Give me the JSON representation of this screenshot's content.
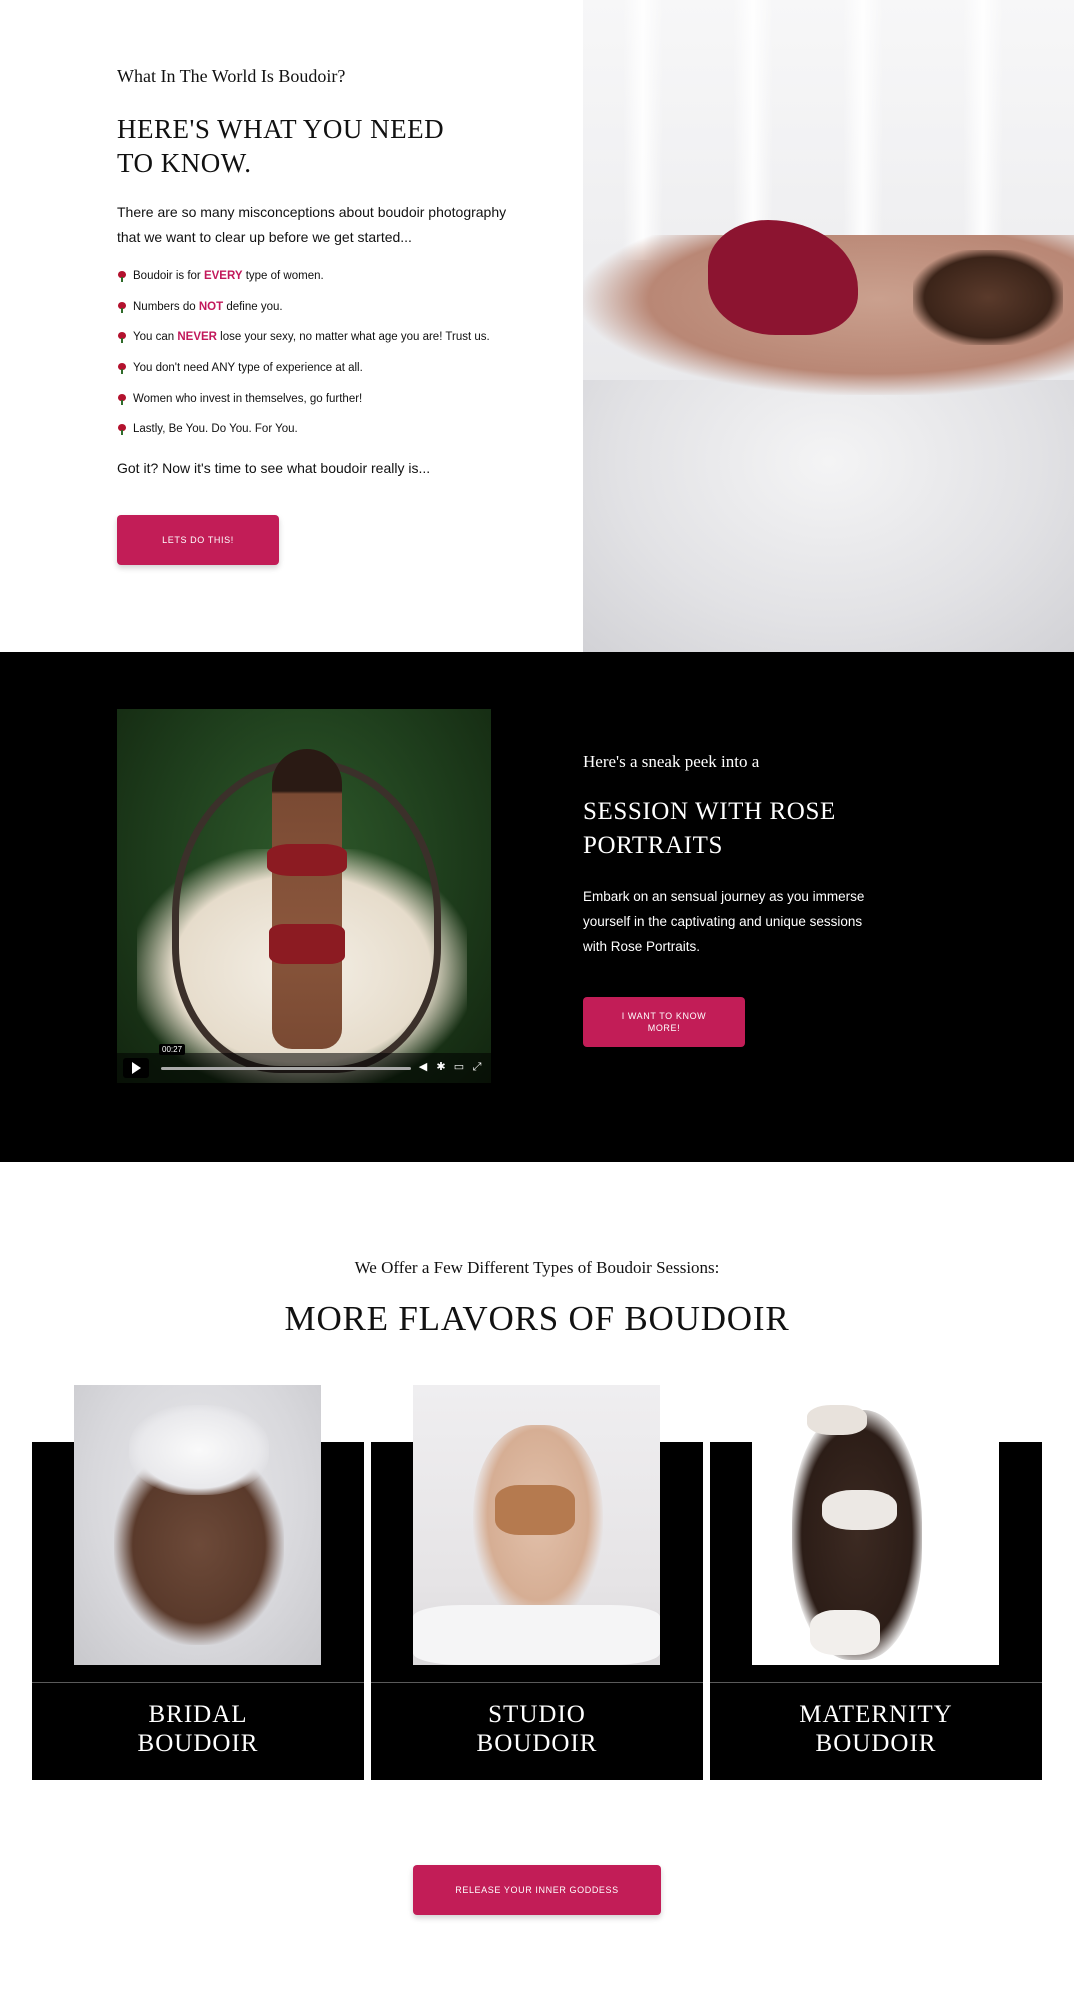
{
  "intro_section": {
    "eyebrow": "What In The World Is Boudoir?",
    "headline": "HERE'S WHAT YOU NEED TO KNOW.",
    "intro": "There are so many misconceptions about boudoir photography that we want to clear up before we get started...",
    "bullets": [
      {
        "before": "Boudoir is for ",
        "highlight": "EVERY",
        "after": " type of women."
      },
      {
        "before": "Numbers do ",
        "highlight": "NOT",
        "after": " define you."
      },
      {
        "before": "You can ",
        "highlight": "NEVER",
        "after": " lose your sexy, no matter what age you are! Trust us."
      },
      {
        "before": "You don't need ANY type of experience at all.",
        "highlight": "",
        "after": ""
      },
      {
        "before": "Women who invest in themselves, go further!",
        "highlight": "",
        "after": ""
      },
      {
        "before": "Lastly, Be You. Do You. For You.",
        "highlight": "",
        "after": ""
      }
    ],
    "closing": "Got it? Now it's time to see what boudoir really is...",
    "cta_label": "LETS DO THIS!"
  },
  "video_section": {
    "eyebrow": "Here's a sneak peek into a",
    "headline": "SESSION WITH ROSE PORTRAITS",
    "body": "Embark on an sensual journey as you immerse yourself in the captivating and unique sessions with Rose Portraits.",
    "cta_label": "I WANT TO KNOW MORE!",
    "video": {
      "timestamp": "00:27",
      "progress": 0.0
    }
  },
  "flavors_section": {
    "eyebrow": "We Offer a Few Different Types of Boudoir Sessions:",
    "headline": "MORE FLAVORS OF BOUDOIR",
    "cards": [
      {
        "line1": "BRIDAL",
        "line2": "BOUDOIR"
      },
      {
        "line1": "STUDIO",
        "line2": "BOUDOIR"
      },
      {
        "line1": "MATERNITY",
        "line2": "BOUDOIR"
      }
    ],
    "cta_label": "RELEASE YOUR INNER GODDESS"
  },
  "colors": {
    "accent": "#c21d57",
    "highlight_text": "#c2185b",
    "dark_bg": "#000000"
  }
}
